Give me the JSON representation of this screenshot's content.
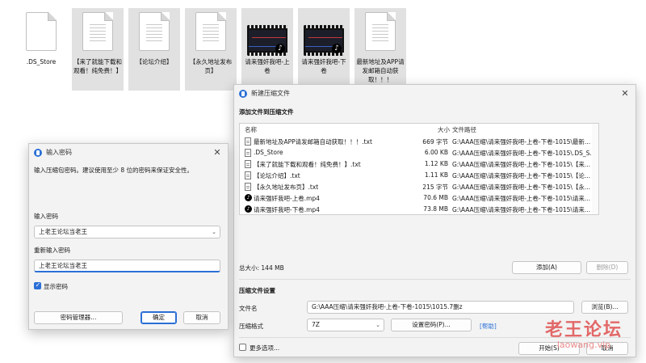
{
  "desktop": {
    "files": [
      {
        "label": ".DS_Store",
        "kind": "doc"
      },
      {
        "label": "【来了就能下载和观看！纯免费！】",
        "kind": "doc"
      },
      {
        "label": "【论坛介绍】",
        "kind": "doc"
      },
      {
        "label": "【永久地址发布页】",
        "kind": "doc"
      },
      {
        "label": "请来强奸我吧-上卷",
        "kind": "video"
      },
      {
        "label": "请来强奸我吧-下卷",
        "kind": "video"
      },
      {
        "label": "最新地址及APP请发邮箱自动获取！！！",
        "kind": "doc"
      }
    ]
  },
  "password_dialog": {
    "title": "输入密码",
    "close": "✕",
    "instruction": "输入压缩包密码。建议使用至少 8 位的密码来保证安全性。",
    "password_label": "输入密码",
    "password_value": "上老王论坛当老王",
    "confirm_label": "重新输入密码",
    "confirm_value": "上老王论坛当老王",
    "show_password_label": "显示密码",
    "show_password_checked": true,
    "manager_button": "密码管理器...",
    "ok_button": "确定",
    "cancel_button": "取消"
  },
  "compress_window": {
    "title": "新建压缩文件",
    "close": "✕",
    "section_add": "添加文件到压缩文件",
    "columns": {
      "name": "名称",
      "size": "大小",
      "path": "文件路径"
    },
    "files": [
      {
        "name": "最新地址及APP请发邮箱自动获取！！！.txt",
        "size": "669 字节",
        "path": "G:\\AAA压缩\\请来强奸我吧-上卷-下卷-1015\\最新...",
        "icon": "doc"
      },
      {
        "name": ".DS_Store",
        "size": "6.00 KB",
        "path": "G:\\AAA压缩\\请来强奸我吧-上卷-下卷-1015\\.DS_S...",
        "icon": "doc"
      },
      {
        "name": "【来了就能下载和观看！纯免费！】.txt",
        "size": "1.12 KB",
        "path": "G:\\AAA压缩\\请来强奸我吧-上卷-下卷-1015\\【来...",
        "icon": "doc"
      },
      {
        "name": "【论坛介绍】.txt",
        "size": "1.11 KB",
        "path": "G:\\AAA压缩\\请来强奸我吧-上卷-下卷-1015\\【论...",
        "icon": "doc"
      },
      {
        "name": "【永久地址发布页】.txt",
        "size": "215 字节",
        "path": "G:\\AAA压缩\\请来强奸我吧-上卷-下卷-1015\\【永...",
        "icon": "doc"
      },
      {
        "name": "请来强奸我吧-上卷.mp4",
        "size": "70.6 MB",
        "path": "G:\\AAA压缩\\请来强奸我吧-上卷-下卷-1015\\请来...",
        "icon": "video"
      },
      {
        "name": "请来强奸我吧-下卷.mp4",
        "size": "73.8 MB",
        "path": "G:\\AAA压缩\\请来强奸我吧-上卷-下卷-1015\\请来...",
        "icon": "video"
      }
    ],
    "total_size": "总大小: 144 MB",
    "add_button": "添加(A)",
    "delete_button": "删除(D)",
    "section_settings": "压缩文件设置",
    "filename_label": "文件名",
    "filename_value": "G:\\AAA压缩\\请来强奸我吧-上卷-下卷-1015\\1015.7删z",
    "browse_button": "浏览(B)...",
    "format_label": "压缩格式",
    "format_value": "7Z",
    "set_password_button": "设置密码(P)...",
    "help_link": "[帮助]",
    "more_options_label": "更多选项...",
    "start_button": "开始(S)",
    "cancel_button": "取消"
  },
  "watermark": {
    "line1": "老王论坛",
    "line2": "laowang.vip"
  },
  "colors": {
    "accent": "#2b6fd6",
    "watermark": "#e05050"
  }
}
